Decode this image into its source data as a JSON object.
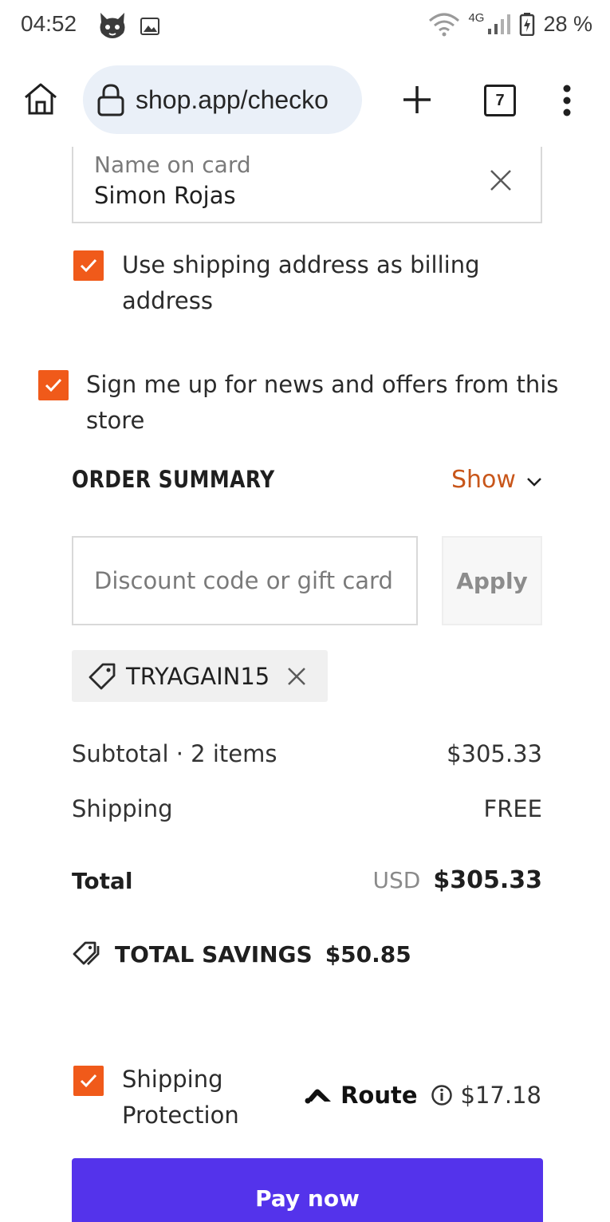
{
  "status_bar": {
    "time": "04:52",
    "network": "4G",
    "battery": "28 %"
  },
  "browser": {
    "url": "shop.app/checko",
    "tab_count": "7"
  },
  "payment": {
    "name_label": "Name on card",
    "name_value": "Simon Rojas"
  },
  "billing_checkbox": {
    "line1": "Use shipping address as billing",
    "line2": "address",
    "checked": true
  },
  "newsletter_checkbox": {
    "line1": "Sign me up for news and offers from this",
    "line2": "store",
    "checked": true
  },
  "order_summary": {
    "title": "ORDER SUMMARY",
    "toggle": "Show"
  },
  "discount": {
    "placeholder": "Discount code or gift card",
    "apply_label": "Apply",
    "applied_code": "TRYAGAIN15"
  },
  "totals": {
    "subtotal_label": "Subtotal · 2 items",
    "subtotal_value": "$305.33",
    "shipping_label": "Shipping",
    "shipping_value": "FREE",
    "total_label": "Total",
    "currency": "USD",
    "total_value": "$305.33",
    "savings_label": "TOTAL SAVINGS",
    "savings_value": "$50.85"
  },
  "protection": {
    "line1": "Shipping",
    "line2": "Protection",
    "provider": "Route",
    "price": "$17.18",
    "checked": true
  },
  "pay_button": {
    "label": "Pay now"
  },
  "colors": {
    "accent_orange": "#f05a1a",
    "link_orange": "#c8561a",
    "pay_purple": "#5433eb"
  }
}
